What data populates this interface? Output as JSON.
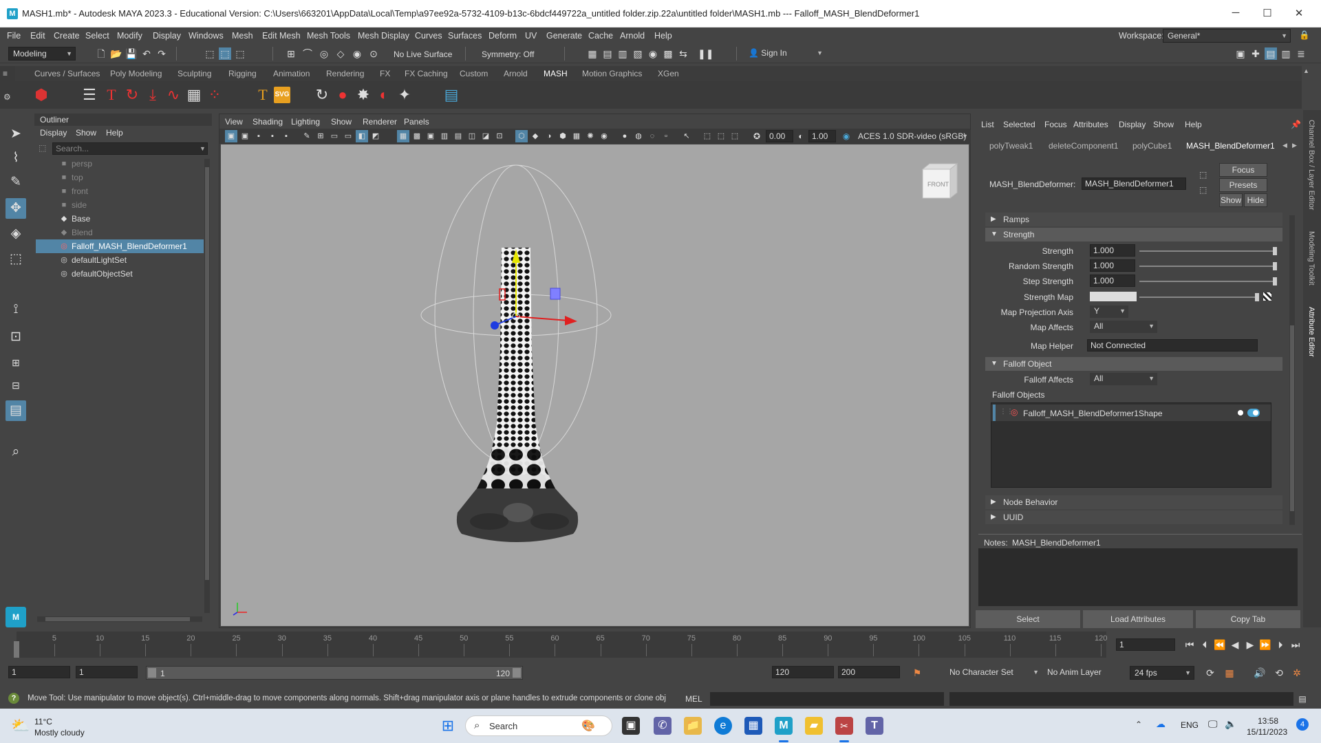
{
  "titlebar": {
    "app_icon": "M",
    "title": "MASH1.mb* - Autodesk MAYA 2023.3 - Educational Version: C:\\Users\\663201\\AppData\\Local\\Temp\\a97ee92a-5732-4109-b13c-6bdcf449722a_untitled folder.zip.22a\\untitled folder\\MASH1.mb   ---   Falloff_MASH_BlendDeformer1",
    "minimize": "─",
    "maximize": "☐",
    "close": "✕"
  },
  "menubar": {
    "items": [
      "File",
      "Edit",
      "Create",
      "Select",
      "Modify",
      "Display",
      "Windows",
      "Mesh",
      "Edit Mesh",
      "Mesh Tools",
      "Mesh Display",
      "Curves",
      "Surfaces",
      "Deform",
      "UV",
      "Generate",
      "Cache",
      "Arnold",
      "Help"
    ],
    "workspace_label": "Workspace:",
    "workspace_value": "General*"
  },
  "statusline": {
    "mode": "Modeling",
    "live_surface": "No Live Surface",
    "symmetry": "Symmetry: Off",
    "sign_in": "Sign In"
  },
  "shelf": {
    "tabs": [
      "Curves / Surfaces",
      "Poly Modeling",
      "Sculpting",
      "Rigging",
      "Animation",
      "Rendering",
      "FX",
      "FX Caching",
      "Custom",
      "Arnold",
      "MASH",
      "Motion Graphics",
      "XGen"
    ],
    "active_tab": "MASH",
    "icons": [
      "mash-network-icon",
      "list-icon",
      "text-icon",
      "rotate-icon",
      "drop-icon",
      "curve-icon",
      "grid-icon",
      "dots-icon",
      "type-icon",
      "svg-icon",
      "loop-icon",
      "sphere-icon",
      "bomb-icon",
      "magnet-icon",
      "satellite-icon",
      "script-icon"
    ],
    "svg_label": "SVG"
  },
  "outliner": {
    "title": "Outliner",
    "menus": [
      "Display",
      "Show",
      "Help"
    ],
    "search_placeholder": "Search...",
    "items": [
      {
        "label": "persp",
        "icon": "camera-icon",
        "dim": true
      },
      {
        "label": "top",
        "icon": "camera-icon",
        "dim": true
      },
      {
        "label": "front",
        "icon": "camera-icon",
        "dim": true
      },
      {
        "label": "side",
        "icon": "camera-icon",
        "dim": true
      },
      {
        "label": "Base",
        "icon": "mesh-icon",
        "dim": false
      },
      {
        "label": "Blend",
        "icon": "mesh-icon",
        "dim": true
      },
      {
        "label": "Falloff_MASH_BlendDeformer1",
        "icon": "falloff-icon",
        "dim": false,
        "selected": true
      },
      {
        "label": "defaultLightSet",
        "icon": "set-icon",
        "dim": false
      },
      {
        "label": "defaultObjectSet",
        "icon": "set-icon",
        "dim": false
      }
    ]
  },
  "viewport": {
    "menus": [
      "View",
      "Shading",
      "Lighting",
      "Show",
      "Renderer",
      "Panels"
    ],
    "exposure": "0.00",
    "gamma": "1.00",
    "color_space": "ACES 1.0 SDR-video (sRGB)",
    "view_cube_label": "FRONT"
  },
  "attribute_editor": {
    "menus": [
      "List",
      "Selected",
      "Focus",
      "Attributes",
      "Display",
      "Show",
      "Help"
    ],
    "tabs": [
      "polyTweak1",
      "deleteComponent1",
      "polyCube1",
      "MASH_BlendDeformer1"
    ],
    "active_tab": "MASH_BlendDeformer1",
    "node_label": "MASH_BlendDeformer:",
    "node_value": "MASH_BlendDeformer1",
    "focus_btn": "Focus",
    "presets_btn": "Presets",
    "show_btn": "Show",
    "hide_btn": "Hide",
    "sections": {
      "ramps": "Ramps",
      "strength": "Strength",
      "falloff_object": "Falloff Object",
      "node_behavior": "Node Behavior",
      "uuid": "UUID"
    },
    "strength_label": "Strength",
    "strength_value": "1.000",
    "strength_level": 1.0,
    "random_strength_label": "Random Strength",
    "random_strength_value": "1.000",
    "random_strength_level": 1.0,
    "step_strength_label": "Step Strength",
    "step_strength_value": "1.000",
    "step_strength_level": 1.0,
    "strength_map_label": "Strength Map",
    "map_projection_axis_label": "Map Projection Axis",
    "map_projection_axis_value": "Y",
    "map_affects_label": "Map Affects",
    "map_affects_value": "All",
    "map_helper_label": "Map Helper",
    "map_helper_value": "Not Connected",
    "falloff_affects_label": "Falloff Affects",
    "falloff_affects_value": "All",
    "falloff_objects_label": "Falloff Objects",
    "falloff_object_item": "Falloff_MASH_BlendDeformer1Shape",
    "notes_label": "Notes:",
    "notes_value": "MASH_BlendDeformer1",
    "select_btn": "Select",
    "load_attributes_btn": "Load Attributes",
    "copy_tab_btn": "Copy Tab"
  },
  "side_tabs": [
    "Channel Box / Layer Editor",
    "Modeling Toolkit",
    "Attribute Editor"
  ],
  "timeline": {
    "ticks": [
      "1",
      "5",
      "10",
      "15",
      "20",
      "25",
      "30",
      "35",
      "40",
      "45",
      "50",
      "55",
      "60",
      "65",
      "70",
      "75",
      "80",
      "85",
      "90",
      "95",
      "100",
      "105",
      "110",
      "115",
      "120"
    ],
    "current_frame": "1"
  },
  "range": {
    "start": "1",
    "playback_start": "1",
    "range_start": "1",
    "range_end": "120",
    "playback_end": "120",
    "end": "200",
    "character_set": "No Character Set",
    "anim_layer": "No Anim Layer",
    "fps": "24 fps"
  },
  "helpline": {
    "text": "Move Tool: Use manipulator to move object(s). Ctrl+middle-drag to move components along normals. Shift+drag manipulator axis or plane handles to extrude components or clone objects. Ctrl+Shift+drag to co",
    "mel_label": "MEL"
  },
  "taskbar": {
    "weather_temp": "11°C",
    "weather_desc": "Mostly cloudy",
    "search": "Search",
    "lang": "ENG",
    "time": "13:58",
    "date": "15/11/2023",
    "notif_count": "4"
  },
  "colors": {
    "selection": "#5285a6",
    "viewport_bg": "#a6a6a6",
    "panel": "#444444"
  }
}
